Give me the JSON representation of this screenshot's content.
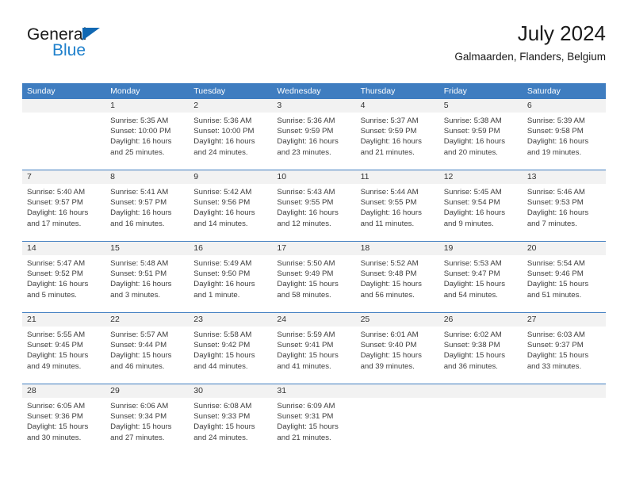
{
  "brand": {
    "name_top": "General",
    "name_bottom": "Blue",
    "triangle_color": "#1168b3",
    "blue_color": "#2081cc"
  },
  "header": {
    "title": "July 2024",
    "subtitle": "Galmaarden, Flanders, Belgium"
  },
  "theme": {
    "header_blue": "#3f7dc0",
    "date_band_gray": "#f2f2f2",
    "text_color": "#3d3d3d"
  },
  "weekdays": [
    "Sunday",
    "Monday",
    "Tuesday",
    "Wednesday",
    "Thursday",
    "Friday",
    "Saturday"
  ],
  "weeks": [
    [
      {
        "day": "",
        "lines": []
      },
      {
        "day": "1",
        "lines": [
          "Sunrise: 5:35 AM",
          "Sunset: 10:00 PM",
          "Daylight: 16 hours",
          "and 25 minutes."
        ]
      },
      {
        "day": "2",
        "lines": [
          "Sunrise: 5:36 AM",
          "Sunset: 10:00 PM",
          "Daylight: 16 hours",
          "and 24 minutes."
        ]
      },
      {
        "day": "3",
        "lines": [
          "Sunrise: 5:36 AM",
          "Sunset: 9:59 PM",
          "Daylight: 16 hours",
          "and 23 minutes."
        ]
      },
      {
        "day": "4",
        "lines": [
          "Sunrise: 5:37 AM",
          "Sunset: 9:59 PM",
          "Daylight: 16 hours",
          "and 21 minutes."
        ]
      },
      {
        "day": "5",
        "lines": [
          "Sunrise: 5:38 AM",
          "Sunset: 9:59 PM",
          "Daylight: 16 hours",
          "and 20 minutes."
        ]
      },
      {
        "day": "6",
        "lines": [
          "Sunrise: 5:39 AM",
          "Sunset: 9:58 PM",
          "Daylight: 16 hours",
          "and 19 minutes."
        ]
      }
    ],
    [
      {
        "day": "7",
        "lines": [
          "Sunrise: 5:40 AM",
          "Sunset: 9:57 PM",
          "Daylight: 16 hours",
          "and 17 minutes."
        ]
      },
      {
        "day": "8",
        "lines": [
          "Sunrise: 5:41 AM",
          "Sunset: 9:57 PM",
          "Daylight: 16 hours",
          "and 16 minutes."
        ]
      },
      {
        "day": "9",
        "lines": [
          "Sunrise: 5:42 AM",
          "Sunset: 9:56 PM",
          "Daylight: 16 hours",
          "and 14 minutes."
        ]
      },
      {
        "day": "10",
        "lines": [
          "Sunrise: 5:43 AM",
          "Sunset: 9:55 PM",
          "Daylight: 16 hours",
          "and 12 minutes."
        ]
      },
      {
        "day": "11",
        "lines": [
          "Sunrise: 5:44 AM",
          "Sunset: 9:55 PM",
          "Daylight: 16 hours",
          "and 11 minutes."
        ]
      },
      {
        "day": "12",
        "lines": [
          "Sunrise: 5:45 AM",
          "Sunset: 9:54 PM",
          "Daylight: 16 hours",
          "and 9 minutes."
        ]
      },
      {
        "day": "13",
        "lines": [
          "Sunrise: 5:46 AM",
          "Sunset: 9:53 PM",
          "Daylight: 16 hours",
          "and 7 minutes."
        ]
      }
    ],
    [
      {
        "day": "14",
        "lines": [
          "Sunrise: 5:47 AM",
          "Sunset: 9:52 PM",
          "Daylight: 16 hours",
          "and 5 minutes."
        ]
      },
      {
        "day": "15",
        "lines": [
          "Sunrise: 5:48 AM",
          "Sunset: 9:51 PM",
          "Daylight: 16 hours",
          "and 3 minutes."
        ]
      },
      {
        "day": "16",
        "lines": [
          "Sunrise: 5:49 AM",
          "Sunset: 9:50 PM",
          "Daylight: 16 hours",
          "and 1 minute."
        ]
      },
      {
        "day": "17",
        "lines": [
          "Sunrise: 5:50 AM",
          "Sunset: 9:49 PM",
          "Daylight: 15 hours",
          "and 58 minutes."
        ]
      },
      {
        "day": "18",
        "lines": [
          "Sunrise: 5:52 AM",
          "Sunset: 9:48 PM",
          "Daylight: 15 hours",
          "and 56 minutes."
        ]
      },
      {
        "day": "19",
        "lines": [
          "Sunrise: 5:53 AM",
          "Sunset: 9:47 PM",
          "Daylight: 15 hours",
          "and 54 minutes."
        ]
      },
      {
        "day": "20",
        "lines": [
          "Sunrise: 5:54 AM",
          "Sunset: 9:46 PM",
          "Daylight: 15 hours",
          "and 51 minutes."
        ]
      }
    ],
    [
      {
        "day": "21",
        "lines": [
          "Sunrise: 5:55 AM",
          "Sunset: 9:45 PM",
          "Daylight: 15 hours",
          "and 49 minutes."
        ]
      },
      {
        "day": "22",
        "lines": [
          "Sunrise: 5:57 AM",
          "Sunset: 9:44 PM",
          "Daylight: 15 hours",
          "and 46 minutes."
        ]
      },
      {
        "day": "23",
        "lines": [
          "Sunrise: 5:58 AM",
          "Sunset: 9:42 PM",
          "Daylight: 15 hours",
          "and 44 minutes."
        ]
      },
      {
        "day": "24",
        "lines": [
          "Sunrise: 5:59 AM",
          "Sunset: 9:41 PM",
          "Daylight: 15 hours",
          "and 41 minutes."
        ]
      },
      {
        "day": "25",
        "lines": [
          "Sunrise: 6:01 AM",
          "Sunset: 9:40 PM",
          "Daylight: 15 hours",
          "and 39 minutes."
        ]
      },
      {
        "day": "26",
        "lines": [
          "Sunrise: 6:02 AM",
          "Sunset: 9:38 PM",
          "Daylight: 15 hours",
          "and 36 minutes."
        ]
      },
      {
        "day": "27",
        "lines": [
          "Sunrise: 6:03 AM",
          "Sunset: 9:37 PM",
          "Daylight: 15 hours",
          "and 33 minutes."
        ]
      }
    ],
    [
      {
        "day": "28",
        "lines": [
          "Sunrise: 6:05 AM",
          "Sunset: 9:36 PM",
          "Daylight: 15 hours",
          "and 30 minutes."
        ]
      },
      {
        "day": "29",
        "lines": [
          "Sunrise: 6:06 AM",
          "Sunset: 9:34 PM",
          "Daylight: 15 hours",
          "and 27 minutes."
        ]
      },
      {
        "day": "30",
        "lines": [
          "Sunrise: 6:08 AM",
          "Sunset: 9:33 PM",
          "Daylight: 15 hours",
          "and 24 minutes."
        ]
      },
      {
        "day": "31",
        "lines": [
          "Sunrise: 6:09 AM",
          "Sunset: 9:31 PM",
          "Daylight: 15 hours",
          "and 21 minutes."
        ]
      },
      {
        "day": "",
        "lines": []
      },
      {
        "day": "",
        "lines": []
      },
      {
        "day": "",
        "lines": []
      }
    ]
  ]
}
